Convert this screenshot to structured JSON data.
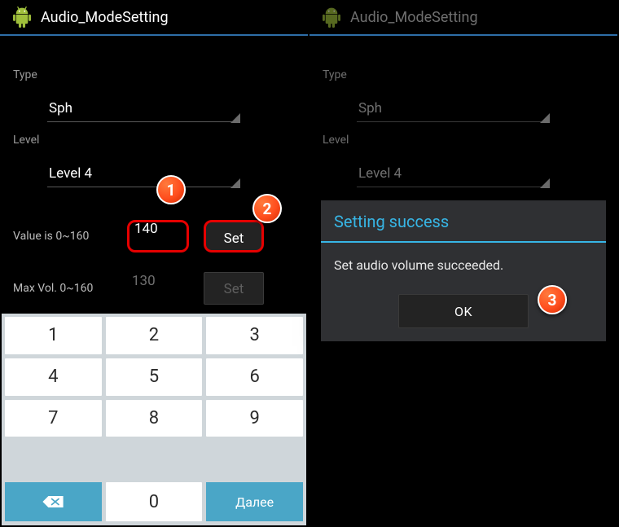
{
  "app": {
    "title": "Audio_ModeSetting",
    "icon": "bugdroid-icon"
  },
  "labels": {
    "type": "Type",
    "level": "Level",
    "value": "Value is 0~160",
    "maxvol": "Max Vol. 0~160"
  },
  "fields": {
    "type_value": "Sph",
    "level_value": "Level 4",
    "value": "140",
    "maxvol_value": "130",
    "set": "Set"
  },
  "keyboard": {
    "keys": [
      "1",
      "2",
      "3",
      "4",
      "5",
      "6",
      "7",
      "8",
      "9",
      "0"
    ],
    "backspace": "⌫",
    "next": "Далее"
  },
  "dialog": {
    "title": "Setting success",
    "body": "Set audio volume succeeded.",
    "ok": "OK"
  },
  "annotations": {
    "b1": "1",
    "b2": "2",
    "b3": "3"
  }
}
